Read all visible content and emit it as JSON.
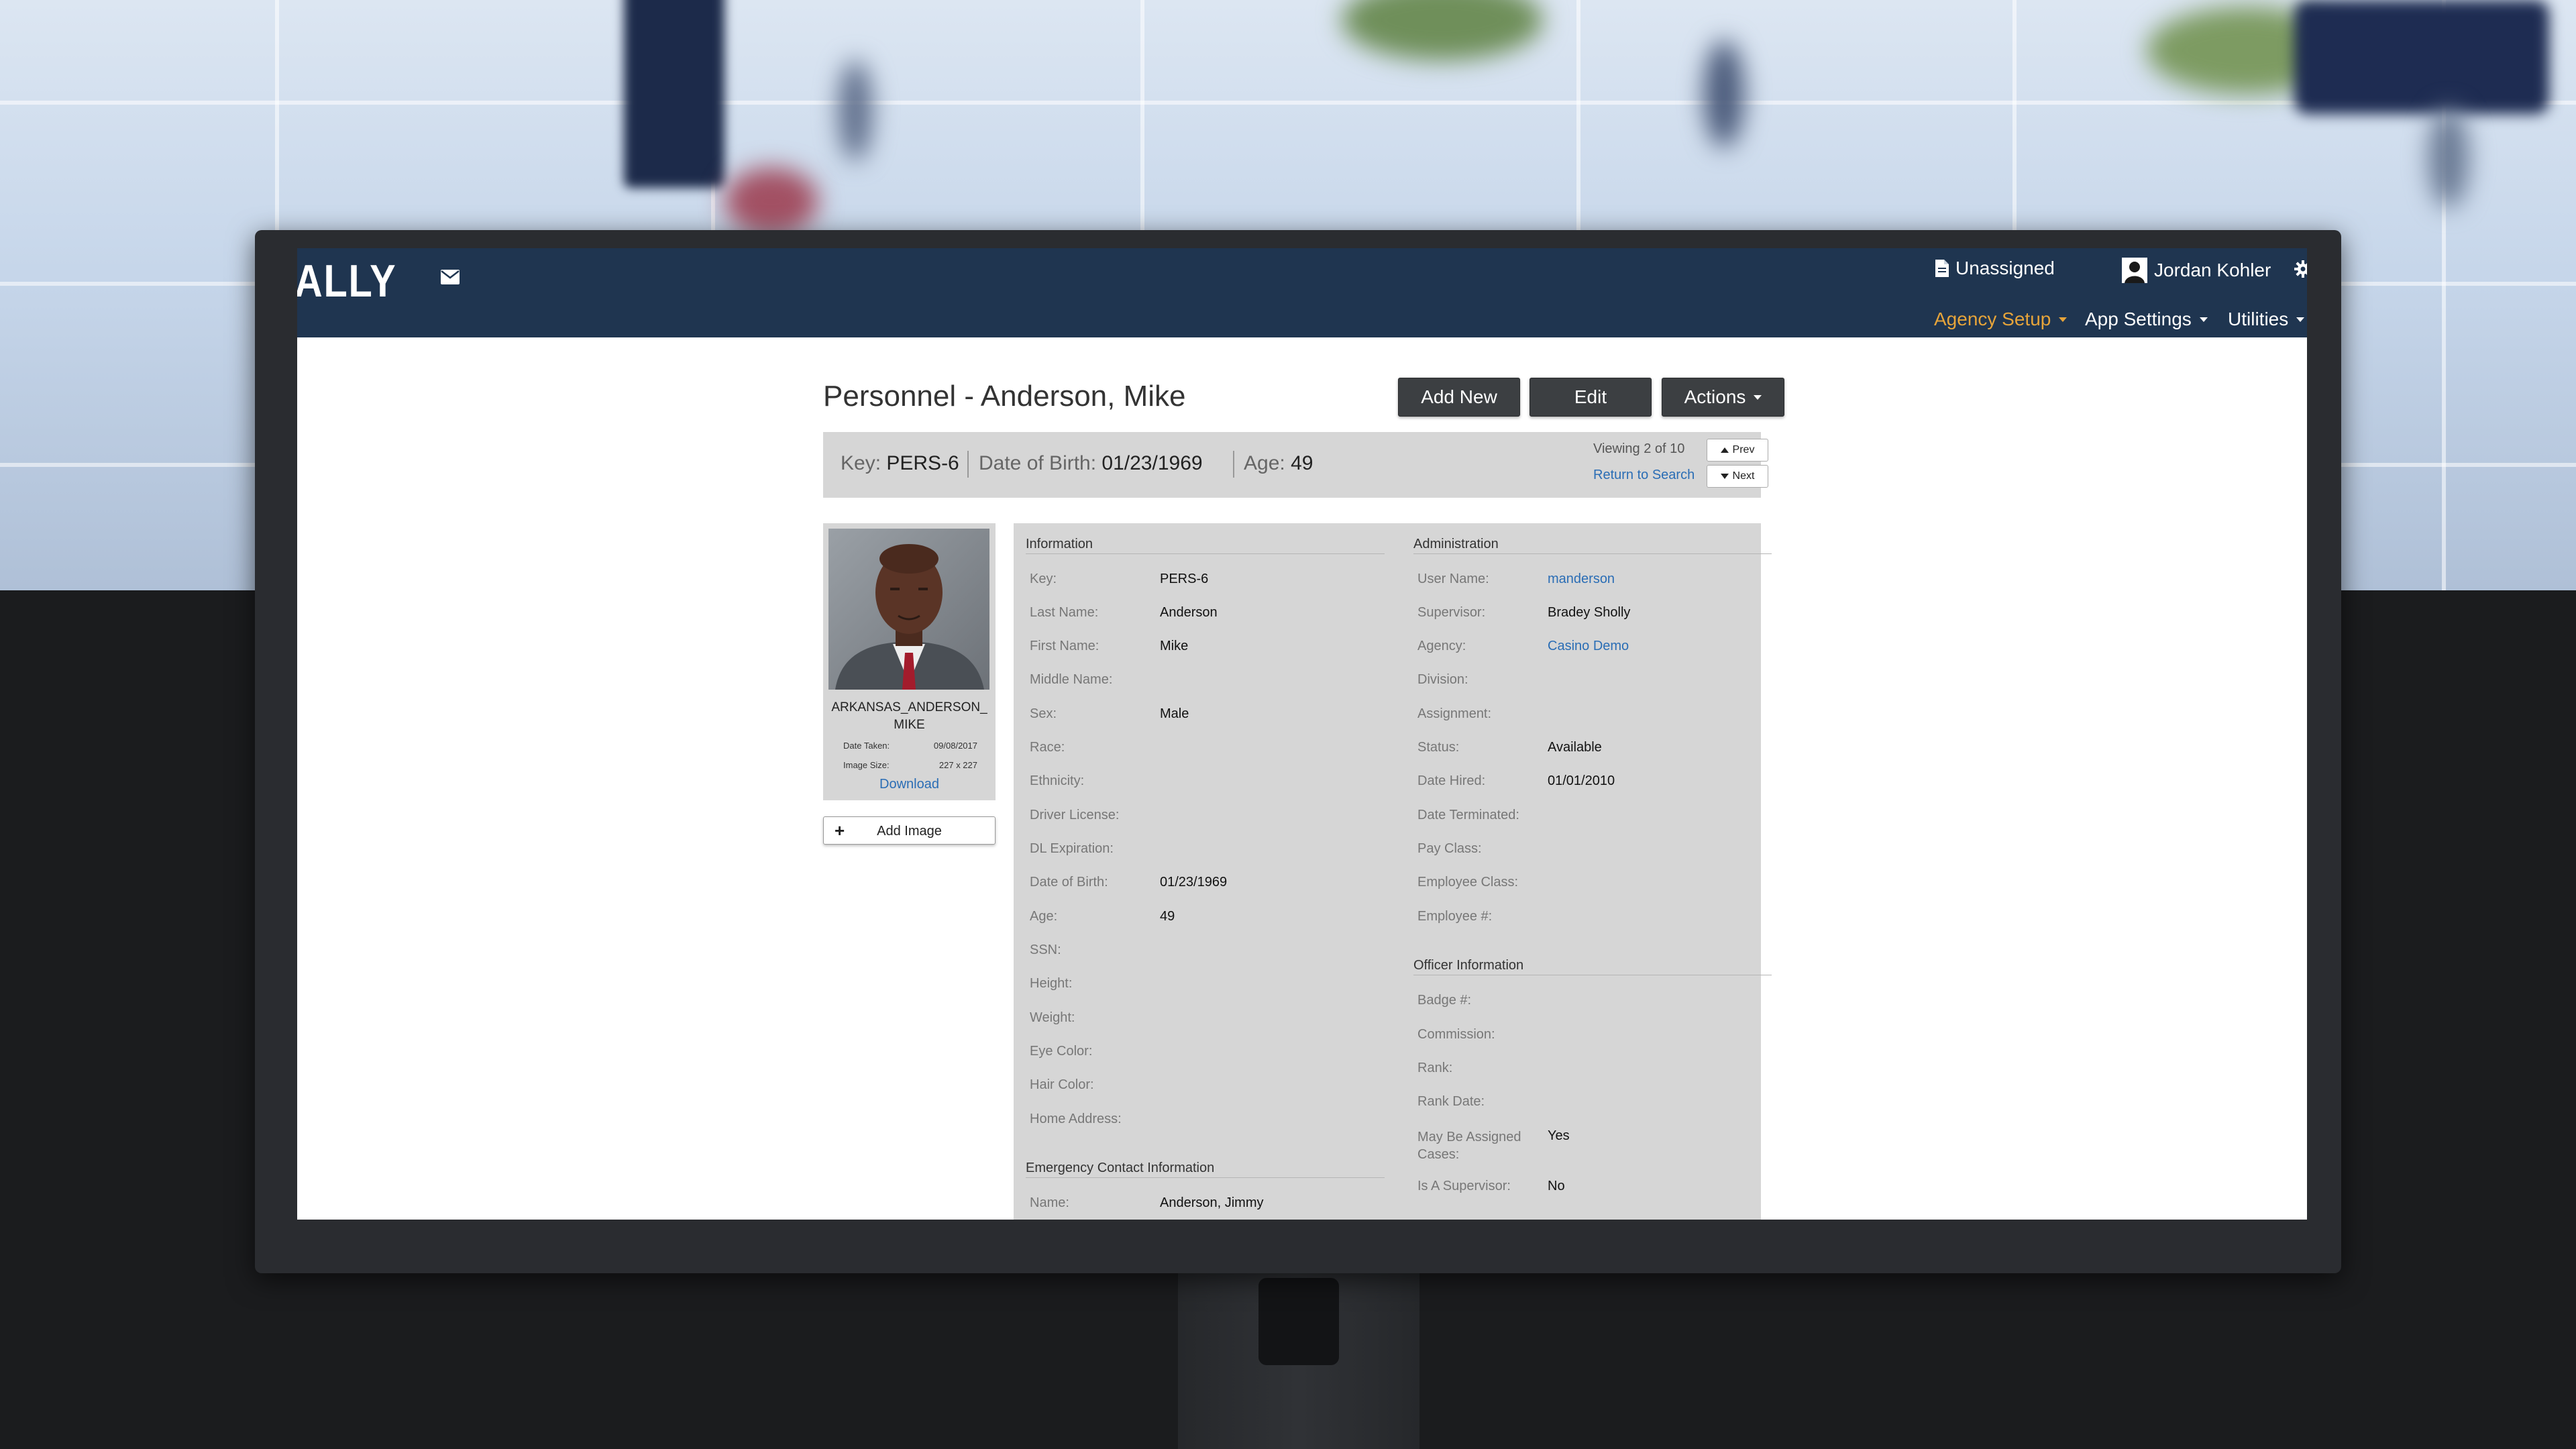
{
  "app": {
    "logo": "ALLY",
    "top_right": {
      "case_status": "Unassigned",
      "user_name": "Jordan Kohler"
    },
    "menu": [
      {
        "label": "Agency Setup",
        "active": true
      },
      {
        "label": "App Settings",
        "active": false
      },
      {
        "label": "Utilities",
        "active": false
      }
    ],
    "colors": {
      "navbar": "#1f3550",
      "accent": "#e6a43a",
      "link": "#2a6db5",
      "panel": "#d6d6d6"
    }
  },
  "header": {
    "title": "Personnel - Anderson, Mike",
    "buttons": {
      "add_new": "Add New",
      "edit": "Edit",
      "actions": "Actions"
    }
  },
  "summary": {
    "key_label": "Key:",
    "key_value": "PERS-6",
    "dob_label": "Date of Birth:",
    "dob_value": "01/23/1969",
    "age_label": "Age:",
    "age_value": "49",
    "viewing": "Viewing 2 of 10",
    "return_link": "Return to Search",
    "prev": "Prev",
    "next": "Next"
  },
  "image": {
    "name_line1": "ARKANSAS_ANDERSON_",
    "name_line2": "MIKE",
    "date_taken_label": "Date Taken:",
    "date_taken_value": "09/08/2017",
    "image_size_label": "Image Size:",
    "image_size_value": "227 x 227",
    "download": "Download",
    "add_image": "Add Image"
  },
  "information": {
    "title": "Information",
    "fields": [
      {
        "label": "Key:",
        "value": "PERS-6"
      },
      {
        "label": "Last Name:",
        "value": "Anderson"
      },
      {
        "label": "First Name:",
        "value": "Mike"
      },
      {
        "label": "Middle Name:",
        "value": ""
      },
      {
        "label": "Sex:",
        "value": "Male"
      },
      {
        "label": "Race:",
        "value": ""
      },
      {
        "label": "Ethnicity:",
        "value": ""
      },
      {
        "label": "Driver License:",
        "value": ""
      },
      {
        "label": "DL Expiration:",
        "value": ""
      },
      {
        "label": "Date of Birth:",
        "value": "01/23/1969"
      },
      {
        "label": "Age:",
        "value": "49"
      },
      {
        "label": "SSN:",
        "value": ""
      },
      {
        "label": "Height:",
        "value": ""
      },
      {
        "label": "Weight:",
        "value": ""
      },
      {
        "label": "Eye Color:",
        "value": ""
      },
      {
        "label": "Hair Color:",
        "value": ""
      },
      {
        "label": "Home Address:",
        "value": ""
      }
    ]
  },
  "emergency": {
    "title": "Emergency Contact Information",
    "fields": [
      {
        "label": "Name:",
        "value": "Anderson, Jimmy"
      }
    ]
  },
  "administration": {
    "title": "Administration",
    "fields": [
      {
        "label": "User Name:",
        "value": "manderson",
        "link": true
      },
      {
        "label": "Supervisor:",
        "value": "Bradey Sholly"
      },
      {
        "label": "Agency:",
        "value": "Casino Demo",
        "link": true
      },
      {
        "label": "Division:",
        "value": ""
      },
      {
        "label": "Assignment:",
        "value": ""
      },
      {
        "label": "Status:",
        "value": "Available"
      },
      {
        "label": "Date Hired:",
        "value": "01/01/2010"
      },
      {
        "label": "Date Terminated:",
        "value": ""
      },
      {
        "label": "Pay Class:",
        "value": ""
      },
      {
        "label": "Employee Class:",
        "value": ""
      },
      {
        "label": "Employee #:",
        "value": ""
      }
    ]
  },
  "officer": {
    "title": "Officer Information",
    "fields": [
      {
        "label": "Badge #:",
        "value": ""
      },
      {
        "label": "Commission:",
        "value": ""
      },
      {
        "label": "Rank:",
        "value": ""
      },
      {
        "label": "Rank Date:",
        "value": ""
      },
      {
        "label": "May Be Assigned Cases:",
        "value": "Yes"
      },
      {
        "label": "Is A Supervisor:",
        "value": "No"
      }
    ]
  }
}
